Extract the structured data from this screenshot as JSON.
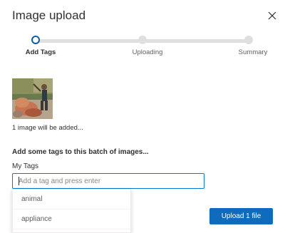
{
  "dialog": {
    "title": "Image upload"
  },
  "stepper": {
    "steps": [
      {
        "label": "Add Tags"
      },
      {
        "label": "Uploading"
      },
      {
        "label": "Summary"
      }
    ]
  },
  "upload": {
    "count_text": "1 image will be added..."
  },
  "tags": {
    "heading": "Add some tags to this batch of images...",
    "label": "My Tags",
    "placeholder": "Add a tag and press enter",
    "suggestions": [
      "animal",
      "appliance"
    ]
  },
  "actions": {
    "primary_label": "Upload 1 file"
  },
  "icons": {
    "close": "close-icon"
  },
  "colors": {
    "accent": "#0f6cbd",
    "active_step_ring": "#0f5f9e",
    "track": "#e1dfdd"
  }
}
